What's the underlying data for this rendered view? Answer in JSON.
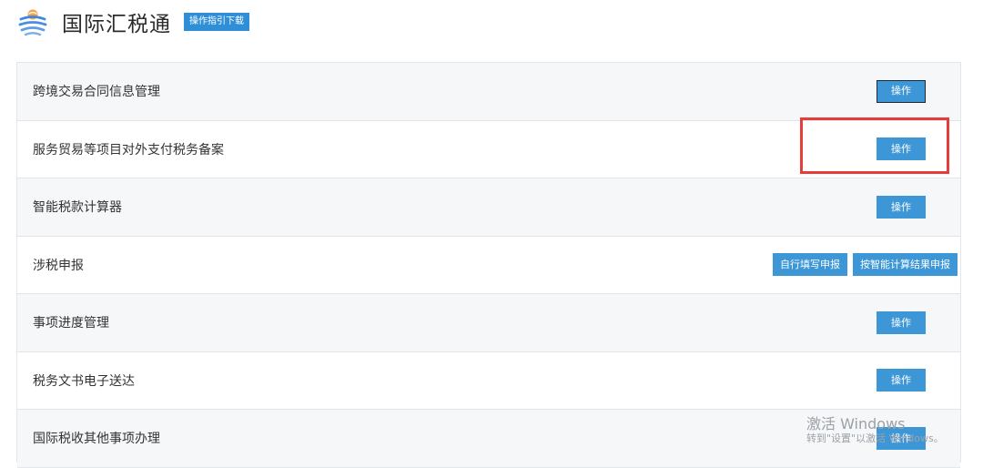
{
  "header": {
    "title": "国际汇税通",
    "guide_button": "操作指引下载",
    "logo_icon": "globe-stack-icon",
    "colors": {
      "logo_orange": "#f0a54a",
      "logo_blue": "#4a8fe0"
    }
  },
  "rows": [
    {
      "label": "跨境交易合同信息管理",
      "action": "操作"
    },
    {
      "label": "服务贸易等项目对外支付税务备案",
      "action": "操作"
    },
    {
      "label": "智能税款计算器",
      "action": "操作"
    },
    {
      "label": "涉税申报",
      "actions": [
        "自行填写申报",
        "按智能计算结果申报"
      ]
    },
    {
      "label": "事项进度管理",
      "action": "操作"
    },
    {
      "label": "税务文书电子送达",
      "action": "操作"
    },
    {
      "label": "国际税收其他事项办理",
      "action": "操作"
    }
  ],
  "watermark": {
    "line1": "激活 Windows",
    "line2": "转到\"设置\"以激活 Windows。"
  },
  "colors": {
    "button": "#3d97d6",
    "guide_button": "#2f8fd6",
    "highlight": "#e43d3a",
    "row_alt": "#f6f7f9"
  }
}
